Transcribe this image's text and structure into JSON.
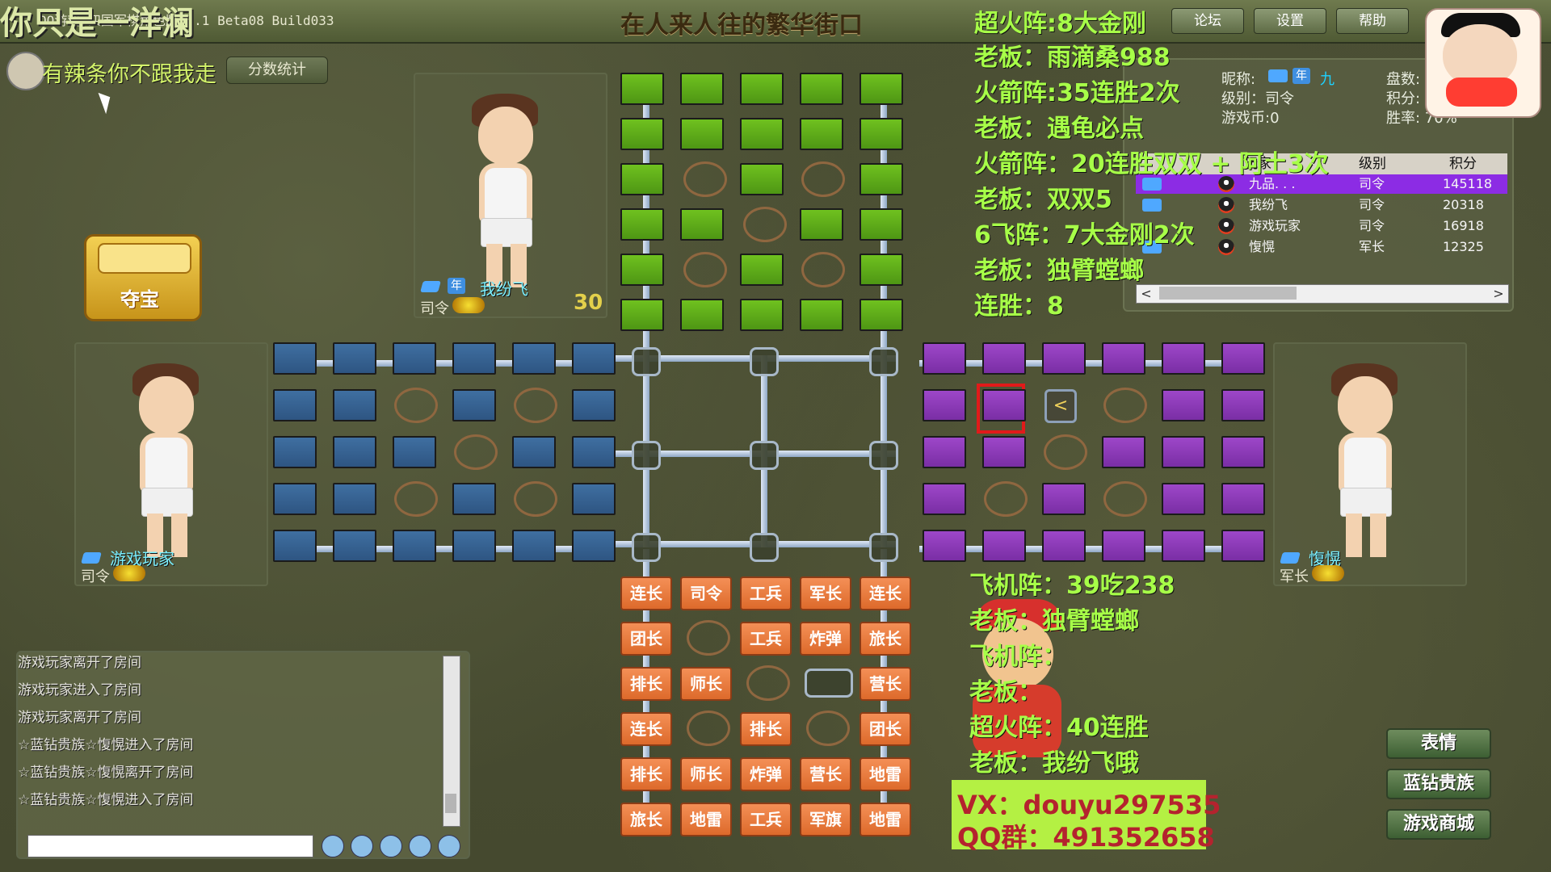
{
  "overlay": {
    "title": "你只是一洋澜",
    "nickname": "有辣条你不跟我走"
  },
  "titlebar": {
    "app_title": "QQ游戏-四国军棋角色版 2.1 Beta08 Build033",
    "center_banner": "在人来人往的繁华街口",
    "buttons": {
      "forum": "论坛",
      "settings": "设置",
      "help": "帮助"
    }
  },
  "left_top": {
    "stats_label": "分数统计"
  },
  "treasure": {
    "label": "夺宝"
  },
  "players": {
    "top": {
      "name": "我纷飞",
      "rank": "司令",
      "score": "30"
    },
    "left": {
      "name": "游戏玩家",
      "rank": "司令"
    },
    "right": {
      "name": "愎愰",
      "rank": "军长"
    }
  },
  "announcements": [
    "超火阵:8大金刚",
    "老板：雨滴桑988",
    "火箭阵:35连胜2次",
    "老板：遇龟必点",
    "火箭阵：20连胜双双 + 阿土3次",
    "老板：双双5",
    "6飞阵：7大金刚2次",
    "老板：独臂螳螂",
    "连胜：8"
  ],
  "bottom_announcements": [
    "飞机阵：39吃238",
    "老板：独臂螳螂",
    "飞机阵：",
    "老板：",
    "超火阵：40连胜",
    "老板：我纷飞哦"
  ],
  "promo": {
    "vx": "VX：douyu297535",
    "qq": "QQ群：491352658"
  },
  "user_panel": {
    "labels": {
      "nickname": "昵称:",
      "level": "级别：司令",
      "coins": "游戏币:0",
      "games": "盘数:",
      "points": "积分:",
      "winrate": "胜率: 70%"
    },
    "nickname_value": "九",
    "table": {
      "headers": [
        "玩家",
        "级别",
        "积分"
      ],
      "rows": [
        {
          "name": "九品. . .",
          "rank": "司令",
          "score": "145118"
        },
        {
          "name": "我纷飞",
          "rank": "司令",
          "score": "20318"
        },
        {
          "name": "游戏玩家",
          "rank": "司令",
          "score": "16918"
        },
        {
          "name": "愎愰",
          "rank": "军长",
          "score": "12325"
        }
      ]
    }
  },
  "board": {
    "orange_rows": [
      [
        "连长",
        "司令",
        "工兵",
        "军长",
        "连长"
      ],
      [
        "团长",
        "",
        "工兵",
        "炸弹",
        "旅长"
      ],
      [
        "排长",
        "师长",
        "",
        "",
        "营长"
      ],
      [
        "连长",
        "",
        "排长",
        "",
        "团长"
      ],
      [
        "排长",
        "师长",
        "炸弹",
        "营长",
        "地雷"
      ],
      [
        "旅长",
        "地雷",
        "工兵",
        "军旗",
        "地雷"
      ]
    ],
    "selected_arrow": "<"
  },
  "chat": {
    "messages": [
      "游戏玩家离开了房间",
      "游戏玩家进入了房间",
      "游戏玩家离开了房间",
      "☆蓝钻贵族☆愎愰进入了房间",
      "☆蓝钻贵族☆愎愰离开了房间",
      "☆蓝钻贵族☆愎愰进入了房间"
    ]
  },
  "side_buttons": {
    "emotion": "表情",
    "blue_diamond": "蓝钻贵族",
    "shop": "游戏商城"
  }
}
